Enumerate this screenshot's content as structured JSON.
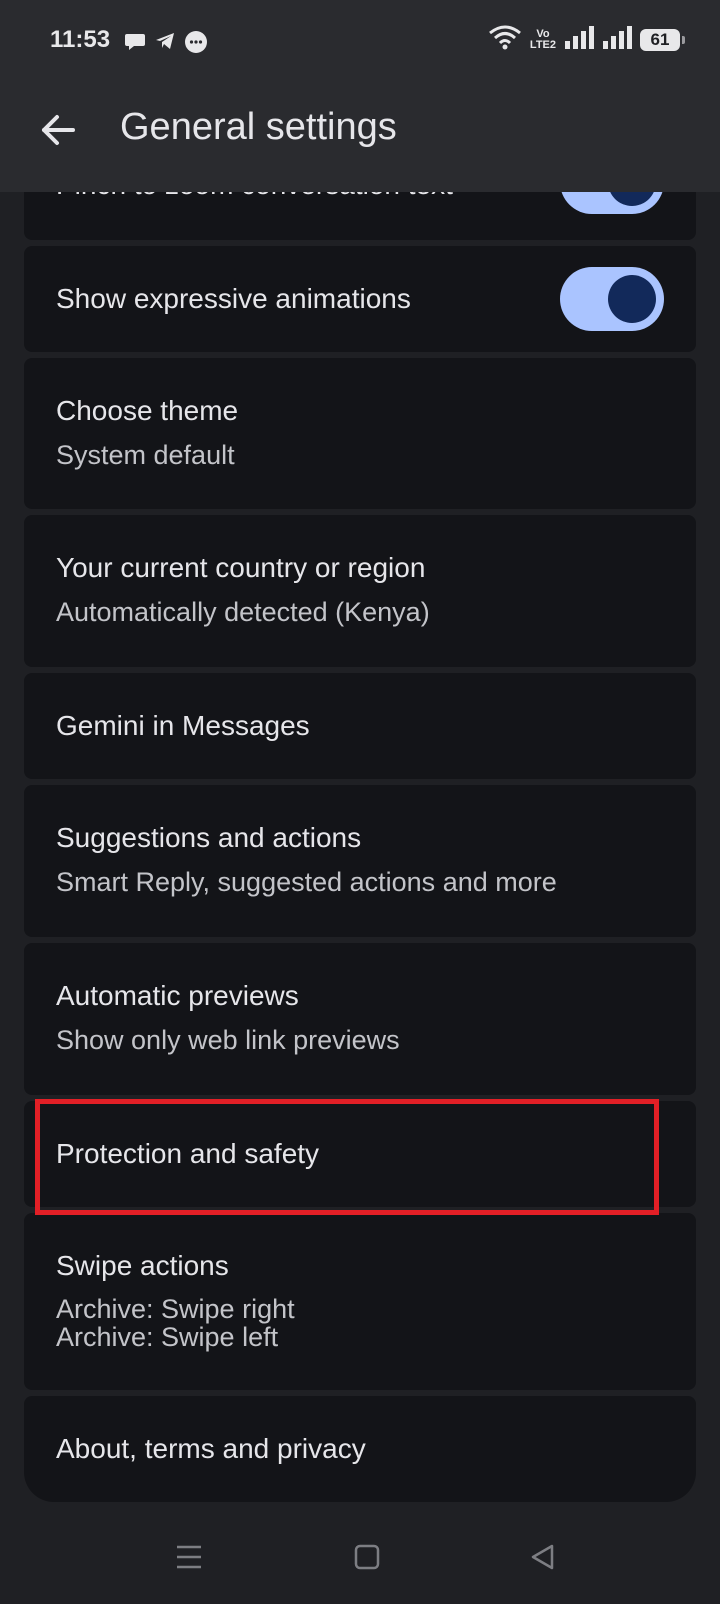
{
  "status_bar": {
    "time": "11:53",
    "network_label_top": "Vo",
    "network_label_bottom": "LTE2",
    "battery": "61"
  },
  "app_bar": {
    "title": "General settings"
  },
  "settings": {
    "pinch_zoom": {
      "title": "Pinch to zoom conversation text",
      "enabled": true
    },
    "expressive": {
      "title": "Show expressive animations",
      "enabled": true
    },
    "theme": {
      "title": "Choose theme",
      "subtitle": "System default"
    },
    "country": {
      "title": "Your current country or region",
      "subtitle": "Automatically detected (Kenya)"
    },
    "gemini": {
      "title": "Gemini in Messages"
    },
    "suggestions": {
      "title": "Suggestions and actions",
      "subtitle": "Smart Reply, suggested actions and more"
    },
    "previews": {
      "title": "Automatic previews",
      "subtitle": "Show only web link previews"
    },
    "protection": {
      "title": "Protection and safety"
    },
    "swipe": {
      "title": "Swipe actions",
      "subtitle_1": "Archive: Swipe right",
      "subtitle_2": "Archive: Swipe left"
    },
    "about": {
      "title": "About, terms and privacy"
    }
  },
  "colors": {
    "accent": "#aac4ff",
    "highlight": "#e21f26",
    "card_bg": "#131418",
    "page_bg": "#1f2024"
  },
  "icons": {
    "back": "arrow-left-icon",
    "nav_menu": "menu-icon",
    "nav_home": "square-icon",
    "nav_back": "triangle-back-icon"
  }
}
